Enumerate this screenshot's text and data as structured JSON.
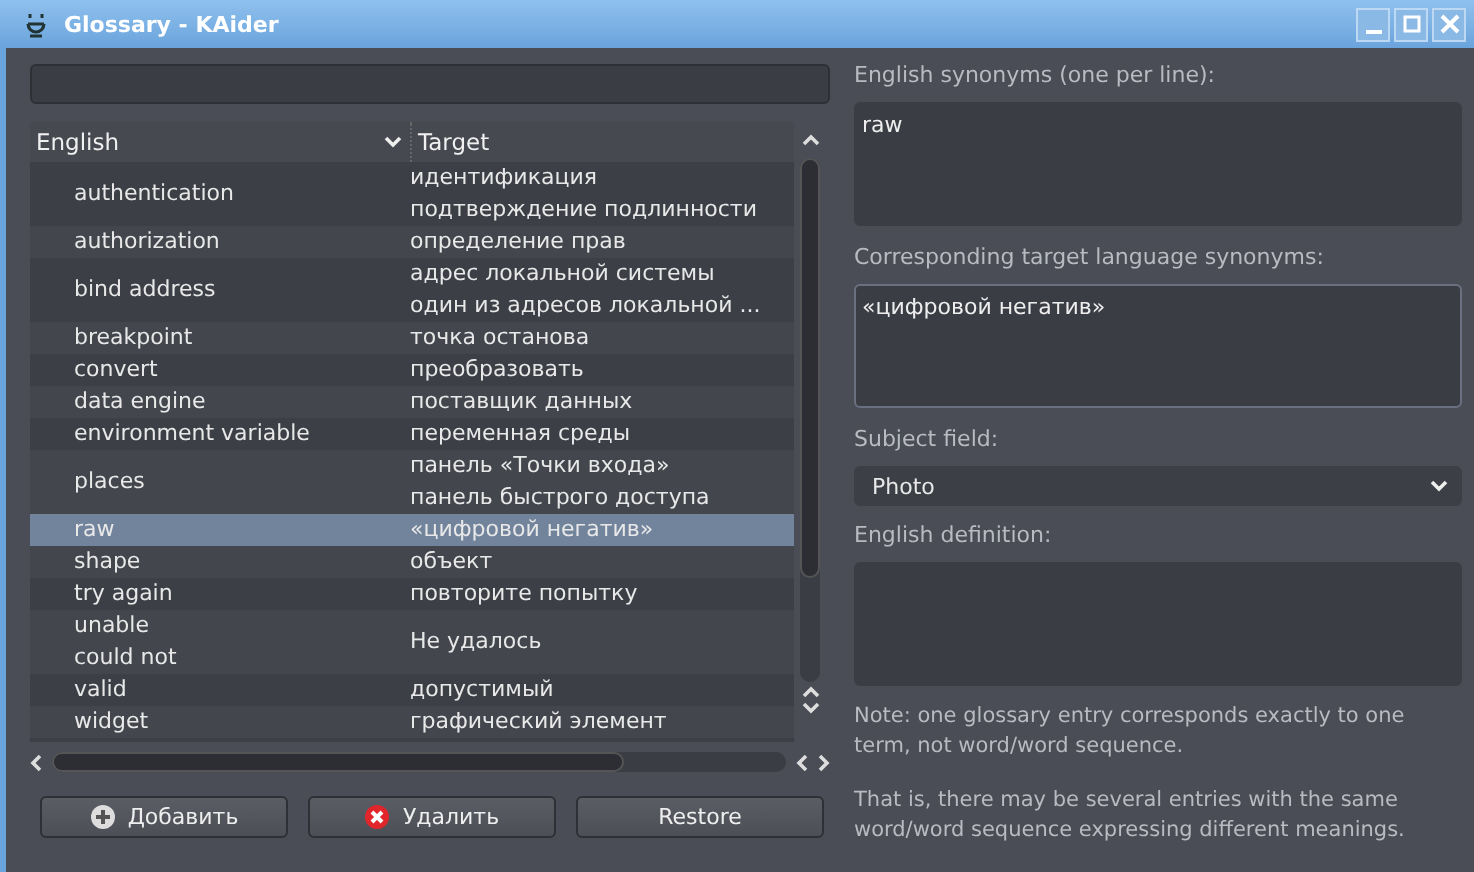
{
  "window": {
    "title": "Glossary - KAider"
  },
  "table": {
    "columns": [
      "English",
      "Target"
    ],
    "rows": [
      {
        "english": [
          "authentication"
        ],
        "target": [
          "идентификация",
          "подтверждение подлинности"
        ],
        "selected": false
      },
      {
        "english": [
          "authorization"
        ],
        "target": [
          "определение прав"
        ],
        "selected": false
      },
      {
        "english": [
          "bind address"
        ],
        "target": [
          "адрес локальной системы",
          "один из адресов локальной ..."
        ],
        "selected": false
      },
      {
        "english": [
          "breakpoint"
        ],
        "target": [
          "точка останова"
        ],
        "selected": false
      },
      {
        "english": [
          "convert"
        ],
        "target": [
          "преобразовать"
        ],
        "selected": false
      },
      {
        "english": [
          "data engine"
        ],
        "target": [
          "поставщик данных"
        ],
        "selected": false
      },
      {
        "english": [
          "environment variable"
        ],
        "target": [
          "переменная среды"
        ],
        "selected": false
      },
      {
        "english": [
          "places"
        ],
        "target": [
          "панель «Точки входа»",
          "панель быстрого доступа"
        ],
        "selected": false
      },
      {
        "english": [
          "raw"
        ],
        "target": [
          "«цифровой негатив»"
        ],
        "selected": true
      },
      {
        "english": [
          "shape"
        ],
        "target": [
          "объект"
        ],
        "selected": false
      },
      {
        "english": [
          "try again"
        ],
        "target": [
          "повторите попытку"
        ],
        "selected": false
      },
      {
        "english": [
          "unable",
          "could not"
        ],
        "target": [
          "Не удалось"
        ],
        "selected": false
      },
      {
        "english": [
          "valid"
        ],
        "target": [
          "допустимый"
        ],
        "selected": false
      },
      {
        "english": [
          "widget"
        ],
        "target": [
          "графический элемент"
        ],
        "selected": false
      }
    ]
  },
  "buttons": [
    {
      "label": "Добавить",
      "kind": "add"
    },
    {
      "label": "Удалить",
      "kind": "remove"
    },
    {
      "label": "Restore",
      "kind": "plain"
    }
  ],
  "editor": {
    "english_synonyms": {
      "label": "English synonyms (one per line):",
      "value": "raw"
    },
    "target_synonyms": {
      "label": "Corresponding target language synonyms:",
      "value": "«цифровой негатив»"
    },
    "subject_field": {
      "label": "Subject field:",
      "value": "Photo"
    },
    "definition": {
      "label": "English definition:"
    },
    "notes": [
      "Note: one glossary entry corresponds exactly to one term, not word/word sequence.",
      "That is, there may be several entries with the same word/word sequence expressing different meanings."
    ]
  }
}
